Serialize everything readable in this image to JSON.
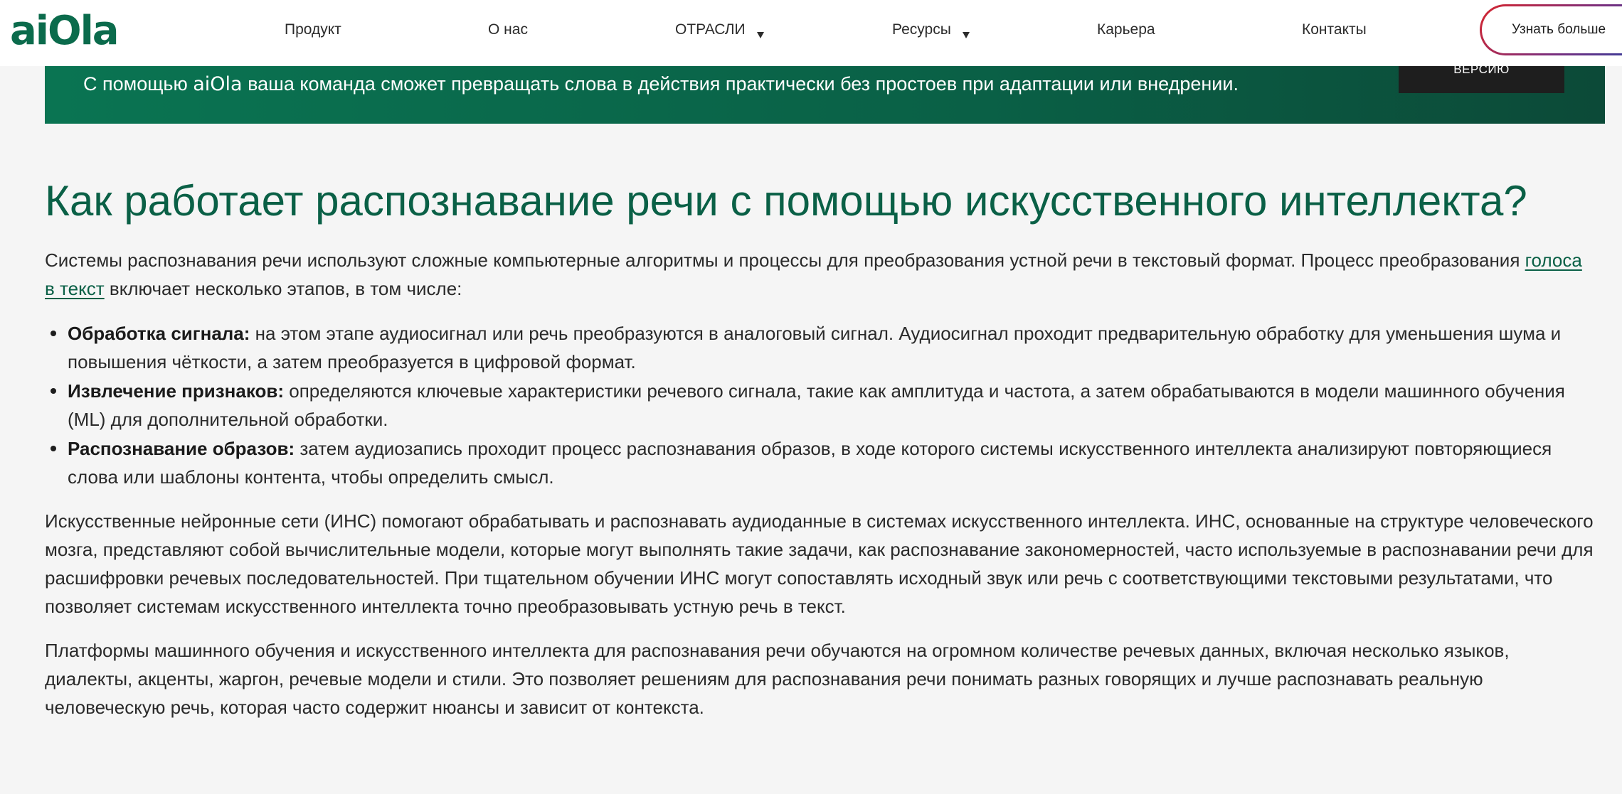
{
  "header": {
    "logo": "aiOla",
    "nav": [
      {
        "label": "Продукт",
        "dropdown": false
      },
      {
        "label": "О нас",
        "dropdown": false
      },
      {
        "label": "ОТРАСЛИ",
        "dropdown": true
      },
      {
        "label": "Ресурсы",
        "dropdown": true
      },
      {
        "label": "Карьера",
        "dropdown": false
      },
      {
        "label": "Контакты",
        "dropdown": false
      }
    ],
    "cta_label": "Узнать больше"
  },
  "banner": {
    "text_before": "С помощью ",
    "brand": "aiOla",
    "text_after": " ваша команда сможет превращать слова в действия практически без простоев при адаптации или внедрении.",
    "button_label": "ВЕРСИЮ"
  },
  "article": {
    "title": "Как работает распознавание речи с помощью искусственного интеллекта?",
    "p1_before": "Системы распознавания речи используют сложные компьютерные алгоритмы и процессы для преобразования устной речи в текстовый формат. Процесс преобразования ",
    "p1_link": "голоса в текст",
    "p1_after": " включает несколько этапов, в том числе:",
    "steps": [
      {
        "term": "Обработка сигнала:",
        "text": " на этом этапе аудиосигнал или речь преобразуются в аналоговый сигнал. Аудиосигнал проходит предварительную обработку для уменьшения шума и повышения чёткости, а затем преобразуется в цифровой формат."
      },
      {
        "term": "Извлечение признаков:",
        "text": " определяются ключевые характеристики речевого сигнала, такие как амплитуда и частота, а затем обрабатываются в модели машинного обучения (ML) для дополнительной обработки."
      },
      {
        "term": "Распознавание образов:",
        "text": " затем аудиозапись проходит процесс распознавания образов, в ходе которого системы искусственного интеллекта анализируют повторяющиеся слова или шаблоны контента, чтобы определить смысл."
      }
    ],
    "p2": "Искусственные нейронные сети (ИНС) помогают обрабатывать и распознавать аудиоданные в системах искусственного интеллекта. ИНС, основанные на структуре человеческого мозга, представляют собой вычислительные модели, которые могут выполнять такие задачи, как распознавание закономерностей, часто используемые в распознавании речи для расшифровки речевых последовательностей. При тщательном обучении ИНС могут сопоставлять исходный звук или речь с соответствующими текстовыми результатами, что позволяет системам искусственного интеллекта точно преобразовывать устную речь в текст.",
    "p3": "Платформы машинного обучения и искусственного интеллекта для распознавания речи обучаются на огромном количестве речевых данных, включая несколько языков, диалекты, акценты, жаргон, речевые модели и стили. Это позволяет решениям для распознавания речи понимать разных говорящих и лучше распознавать реальную человеческую речь, которая часто содержит нюансы и зависит от контекста."
  }
}
